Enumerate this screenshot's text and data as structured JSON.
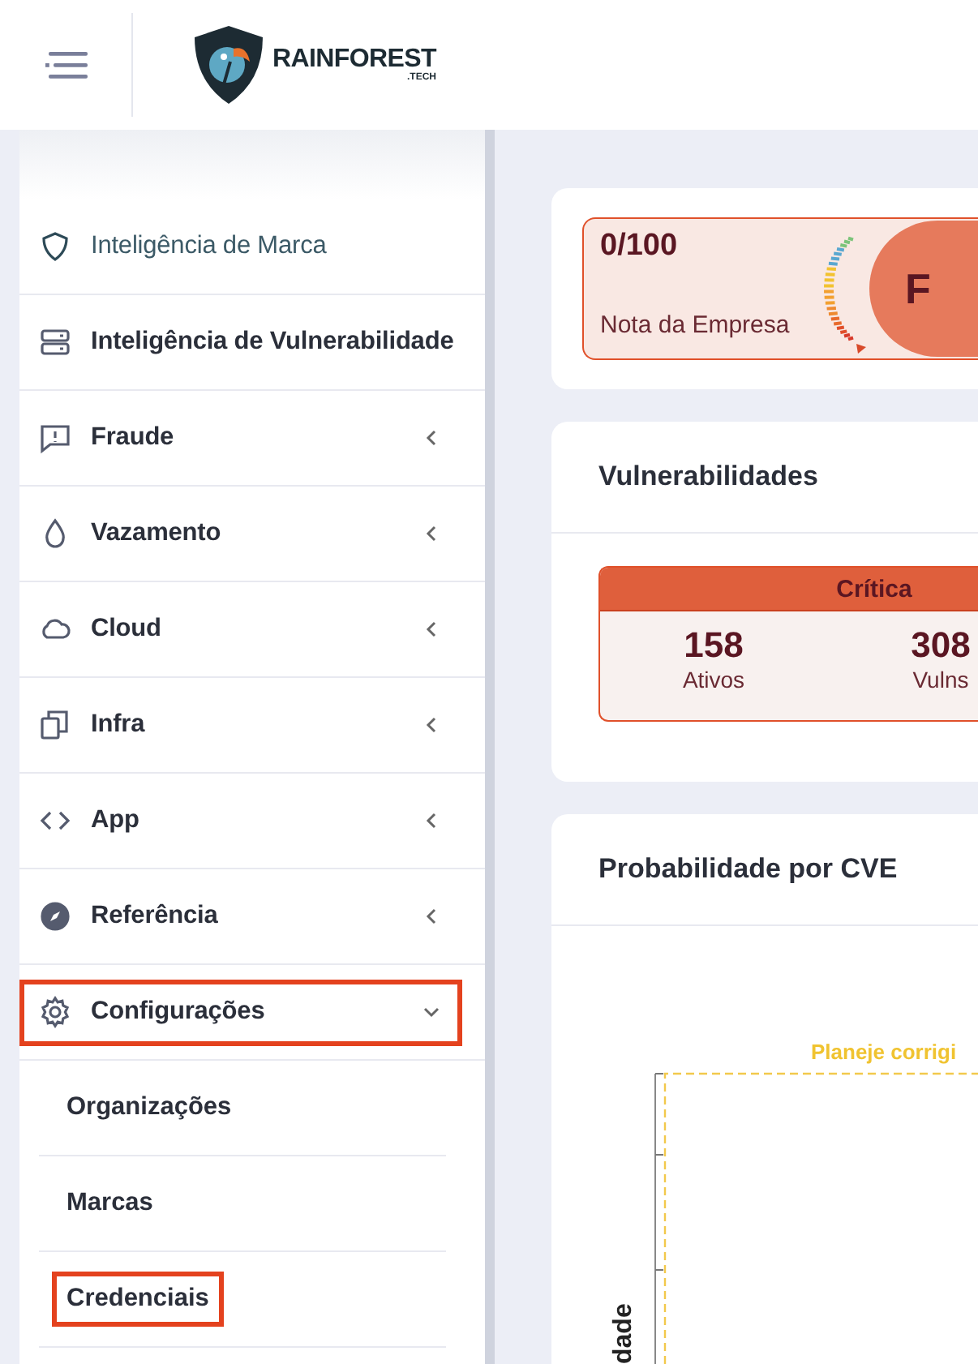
{
  "header": {
    "logo": {
      "name": "RAINFOREST",
      "suffix": ".TECH"
    }
  },
  "sidebar": {
    "items": [
      {
        "label": "Inteligência de Marca",
        "selected": true,
        "highlighted": false
      },
      {
        "label": "Inteligência de Vulnerabilidade",
        "selected": false,
        "highlighted": false
      },
      {
        "label": "Fraude",
        "selected": false,
        "highlighted": false,
        "expanded": false
      },
      {
        "label": "Vazamento",
        "selected": false,
        "highlighted": false,
        "expanded": false
      },
      {
        "label": "Cloud",
        "selected": false,
        "highlighted": false,
        "expanded": false
      },
      {
        "label": "Infra",
        "selected": false,
        "highlighted": false,
        "expanded": false
      },
      {
        "label": "App",
        "selected": false,
        "highlighted": false,
        "expanded": false
      },
      {
        "label": "Referência",
        "selected": false,
        "highlighted": false,
        "expanded": false
      },
      {
        "label": "Configurações",
        "selected": false,
        "highlighted": true,
        "expanded": true,
        "children": [
          {
            "label": "Organizações",
            "highlighted": false
          },
          {
            "label": "Marcas",
            "highlighted": false
          },
          {
            "label": "Credenciais",
            "highlighted": true
          }
        ]
      }
    ]
  },
  "score": {
    "value": "0/100",
    "label": "Nota da Empresa",
    "grade": "F"
  },
  "vulnerabilities": {
    "title": "Vulnerabilidades",
    "severity": "Crítica",
    "stats": [
      {
        "value": "158",
        "label": "Ativos"
      },
      {
        "value": "308",
        "label": "Vulns"
      }
    ]
  },
  "probability": {
    "title": "Probabilidade por CVE",
    "annotation": "Planeje corrigi",
    "ylabel": "dade"
  }
}
